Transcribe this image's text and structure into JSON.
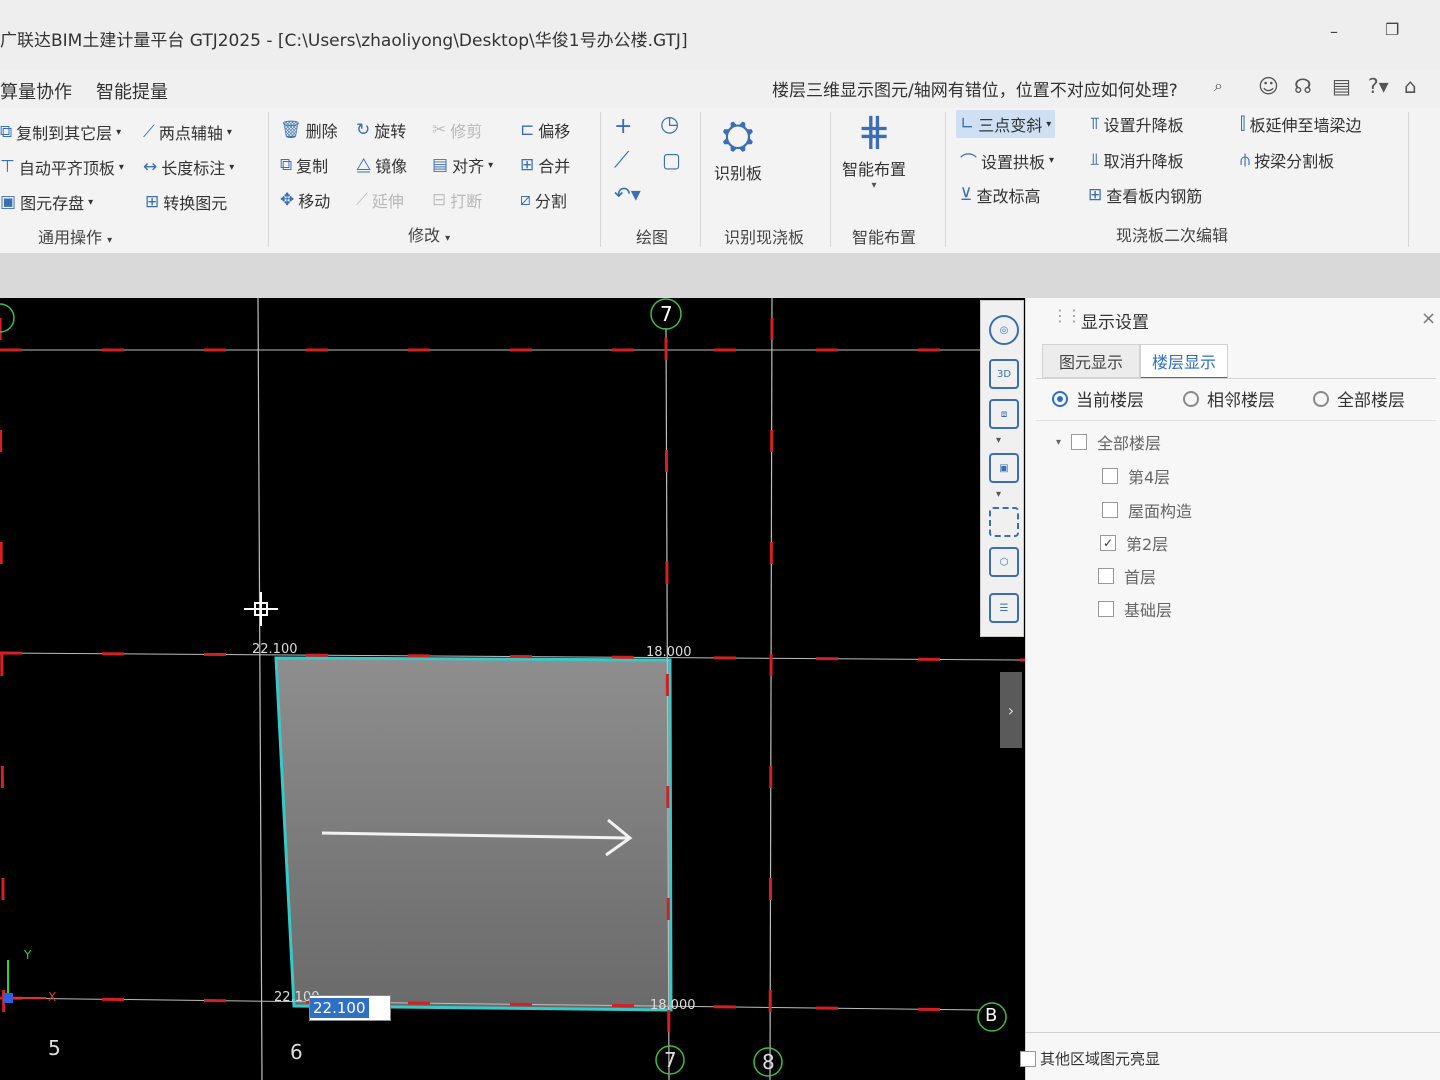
{
  "window": {
    "title": "广联达BIM土建计量平台 GTJ2025 - [C:\\Users\\zhaoliyong\\Desktop\\华俊1号办公楼.GTJ]",
    "minimize_glyph": "–",
    "restore_glyph": "❐"
  },
  "menu": {
    "items": [
      "算量协作",
      "智能提量"
    ],
    "help_question": "楼层三维显示图元/轴网有错位，位置不对应如何处理?",
    "icons": [
      "search-icon",
      "user-icon",
      "headset-icon",
      "calendar-icon",
      "help-icon",
      "shirt-icon"
    ]
  },
  "ribbon": {
    "general": {
      "copy_to_floor": "复制到其它层",
      "auto_align_top": "自动平齐顶板",
      "save_element": "图元存盘",
      "two_point_axis": "两点辅轴",
      "length_mark": "长度标注",
      "convert_element": "转换图元",
      "group_label": "通用操作"
    },
    "modify": {
      "delete": "删除",
      "copy": "复制",
      "move": "移动",
      "rotate": "旋转",
      "mirror": "镜像",
      "extend": "延伸",
      "trim": "修剪",
      "align": "对齐",
      "break": "打断",
      "offset": "偏移",
      "merge": "合并",
      "split": "分割",
      "group_label": "修改"
    },
    "draw": {
      "group_label": "绘图"
    },
    "identify": {
      "big_label": "识别板",
      "group_label": "识别现浇板"
    },
    "smart": {
      "big_label": "智能布置",
      "group_label": "智能布置"
    },
    "slab_edit": {
      "three_point_slope": "三点变斜",
      "set_arch": "设置拱板",
      "check_elevation": "查改标高",
      "set_raise": "设置升降板",
      "cancel_raise": "取消升降板",
      "view_rebar": "查看板内钢筋",
      "extend_to_wall": "板延伸至墙梁边",
      "split_by_beam": "按梁分割板",
      "group_label": "现浇板二次编辑"
    }
  },
  "canvas": {
    "axis_labels": [
      "7",
      "5",
      "6",
      "7",
      "8",
      "B"
    ],
    "elevations": [
      "22.100",
      "18.000",
      "22.100",
      "18.000"
    ],
    "input_value": "22.100",
    "axis_x": "X",
    "axis_y": "Y"
  },
  "panel": {
    "title": "显示设置",
    "tabs": [
      "图元显示",
      "楼层显示"
    ],
    "active_tab": 1,
    "radios": [
      "当前楼层",
      "相邻楼层",
      "全部楼层"
    ],
    "selected_radio": 0,
    "tree_root": "全部楼层",
    "floors": [
      {
        "name": "第4层",
        "checked": false
      },
      {
        "name": "屋面构造",
        "checked": false
      },
      {
        "name": "第2层",
        "checked": true
      },
      {
        "name": "首层",
        "checked": false
      },
      {
        "name": "基础层",
        "checked": false
      }
    ],
    "footer_option": "其他区域图元亮显"
  },
  "colors": {
    "accent": "#3a6fb5",
    "slab_edge": "#38c8c8",
    "grid_red": "#d42020"
  }
}
